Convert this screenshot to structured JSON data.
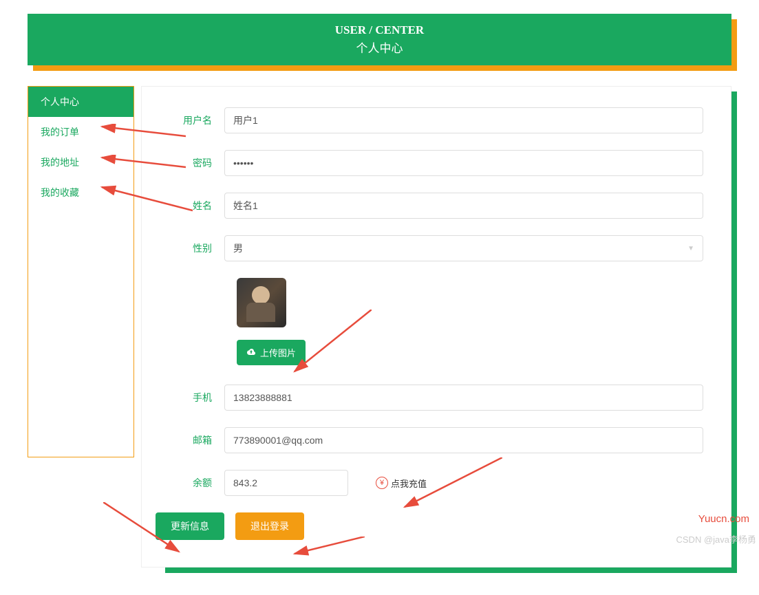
{
  "header": {
    "title_en": "USER / CENTER",
    "title_cn": "个人中心"
  },
  "sidebar": {
    "items": [
      {
        "label": "个人中心",
        "active": true
      },
      {
        "label": "我的订单",
        "active": false
      },
      {
        "label": "我的地址",
        "active": false
      },
      {
        "label": "我的收藏",
        "active": false
      }
    ]
  },
  "form": {
    "username_label": "用户名",
    "username_value": "用户1",
    "password_label": "密码",
    "password_value": "••••••",
    "name_label": "姓名",
    "name_value": "姓名1",
    "gender_label": "性别",
    "gender_value": "男",
    "upload_label": "上传图片",
    "phone_label": "手机",
    "phone_value": "13823888881",
    "email_label": "邮箱",
    "email_value": "773890001@qq.com",
    "balance_label": "余额",
    "balance_value": "843.2",
    "recharge_label": "点我充值"
  },
  "actions": {
    "update_label": "更新信息",
    "logout_label": "退出登录"
  },
  "watermark": {
    "csdn": "CSDN @java李杨勇",
    "site": "Yuucn.com"
  }
}
